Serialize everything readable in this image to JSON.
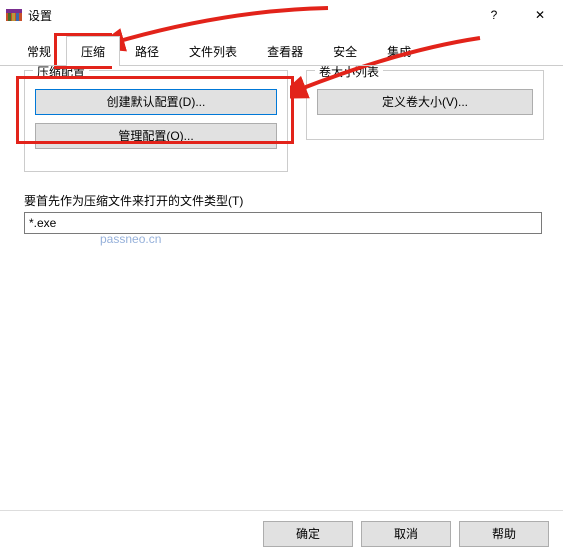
{
  "window": {
    "title": "设置",
    "help_glyph": "?",
    "close_glyph": "✕"
  },
  "tabs": {
    "items": [
      {
        "label": "常规"
      },
      {
        "label": "压缩"
      },
      {
        "label": "路径"
      },
      {
        "label": "文件列表"
      },
      {
        "label": "查看器"
      },
      {
        "label": "安全"
      },
      {
        "label": "集成"
      }
    ],
    "active_index": 1
  },
  "group_left": {
    "legend": "压缩配置",
    "btn_create": "创建默认配置(D)...",
    "btn_manage": "管理配置(O)..."
  },
  "group_right": {
    "legend": "卷大小列表",
    "btn_define": "定义卷大小(V)..."
  },
  "filetypes": {
    "label": "要首先作为压缩文件来打开的文件类型(T)",
    "value": "*.exe"
  },
  "watermark": "passneo.cn",
  "footer": {
    "ok": "确定",
    "cancel": "取消",
    "help": "帮助"
  }
}
